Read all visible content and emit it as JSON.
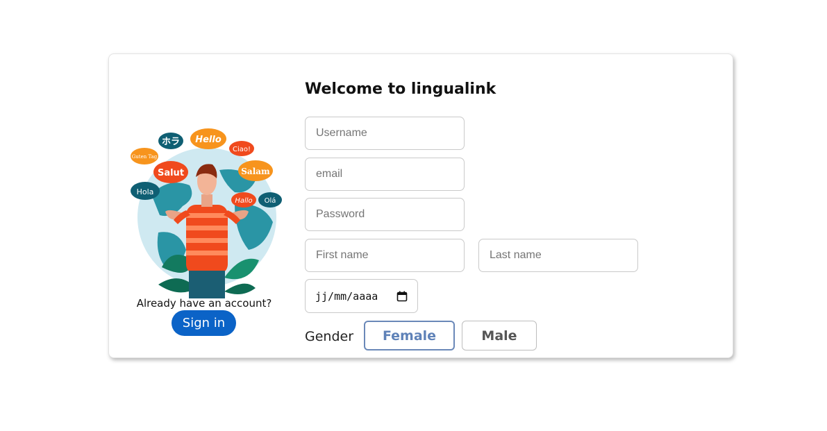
{
  "app": {
    "title": "Welcome to lingualink"
  },
  "illustration": {
    "bubbles": [
      "ホラ",
      "Hello",
      "Guten Tag",
      "Ciao!",
      "Salut",
      "Salam",
      "Hola",
      "Hallo",
      "Olá"
    ]
  },
  "signin_panel": {
    "prompt": "Already have an account?",
    "signin_label": "Sign in"
  },
  "form": {
    "username_placeholder": "Username",
    "email_placeholder": "email",
    "password_placeholder": "Password",
    "first_name_placeholder": "First name",
    "last_name_placeholder": "Last name",
    "date_display": "jj/mm/aaaa",
    "gender_label": "Gender",
    "gender_options": [
      "Female",
      "Male"
    ],
    "gender_selected": "Female"
  },
  "colors": {
    "accent": "#0b63c7",
    "selected_border": "#6a88b8"
  }
}
